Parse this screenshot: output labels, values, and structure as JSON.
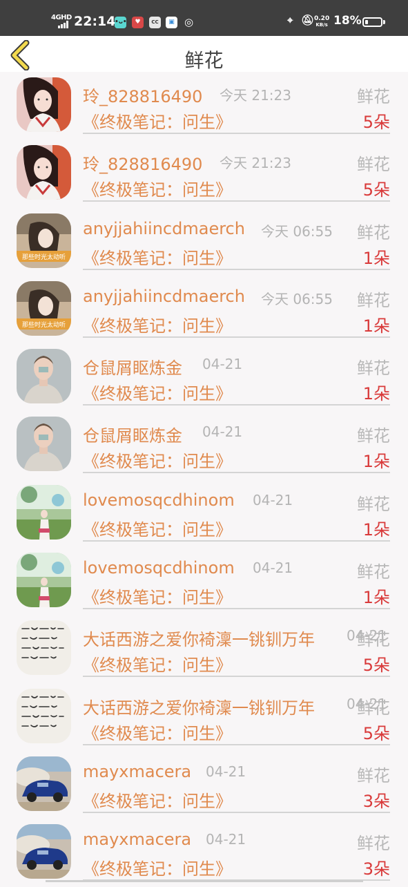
{
  "status_bar": {
    "network": "4GHD",
    "time": "22:14",
    "speed_value": "0.20",
    "speed_unit": "KB/s",
    "battery": "18%",
    "battery_level": 0.18
  },
  "header": {
    "title": "鲜花",
    "back_icon": "chevron-left-icon"
  },
  "items": [
    {
      "name": "玲_828816490",
      "time": "今天 21:23",
      "kind": "鲜花",
      "book": "《终极笔记：问生》",
      "qty": "5朵",
      "avatar": "girl-hanfu"
    },
    {
      "name": "玲_828816490",
      "time": "今天 21:23",
      "kind": "鲜花",
      "book": "《终极笔记：问生》",
      "qty": "5朵",
      "avatar": "girl-hanfu"
    },
    {
      "name": "anyjjahiincdmaerch",
      "time": "今天 06:55",
      "kind": "鲜花",
      "book": "《终极笔记：问生》",
      "qty": "1朵",
      "avatar": "girl-banner"
    },
    {
      "name": "anyjjahiincdmaerch",
      "time": "今天 06:55",
      "kind": "鲜花",
      "book": "《终极笔记：问生》",
      "qty": "1朵",
      "avatar": "girl-banner"
    },
    {
      "name": "仓鼠屑眍炼金",
      "time": "04-21",
      "kind": "鲜花",
      "book": "《终极笔记：问生》",
      "qty": "1朵",
      "avatar": "man-portrait"
    },
    {
      "name": "仓鼠屑眍炼金",
      "time": "04-21",
      "kind": "鲜花",
      "book": "《终极笔记：问生》",
      "qty": "1朵",
      "avatar": "man-portrait"
    },
    {
      "name": "lovemosqcdhinom",
      "time": "04-21",
      "kind": "鲜花",
      "book": "《终极笔记：问生》",
      "qty": "1朵",
      "avatar": "girl-field"
    },
    {
      "name": "lovemosqcdhinom",
      "time": "04-21",
      "kind": "鲜花",
      "book": "《终极笔记：问生》",
      "qty": "1朵",
      "avatar": "girl-field"
    },
    {
      "name": "大话西游之爱你裿澟一铫钏万年",
      "time": "04-21",
      "kind": "鲜花",
      "book": "《终极笔记：问生》",
      "qty": "5朵",
      "avatar": "handwriting"
    },
    {
      "name": "大话西游之爱你裿澟一铫钏万年",
      "time": "04-21",
      "kind": "鲜花",
      "book": "《终极笔记：问生》",
      "qty": "5朵",
      "avatar": "handwriting"
    },
    {
      "name": "mayxmacera",
      "time": "04-21",
      "kind": "鲜花",
      "book": "《终极笔记：问生》",
      "qty": "3朵",
      "avatar": "rally-car"
    },
    {
      "name": "mayxmacera",
      "time": "04-21",
      "kind": "鲜花",
      "book": "《终极笔记：问生》",
      "qty": "3朵",
      "avatar": "rally-car"
    }
  ]
}
